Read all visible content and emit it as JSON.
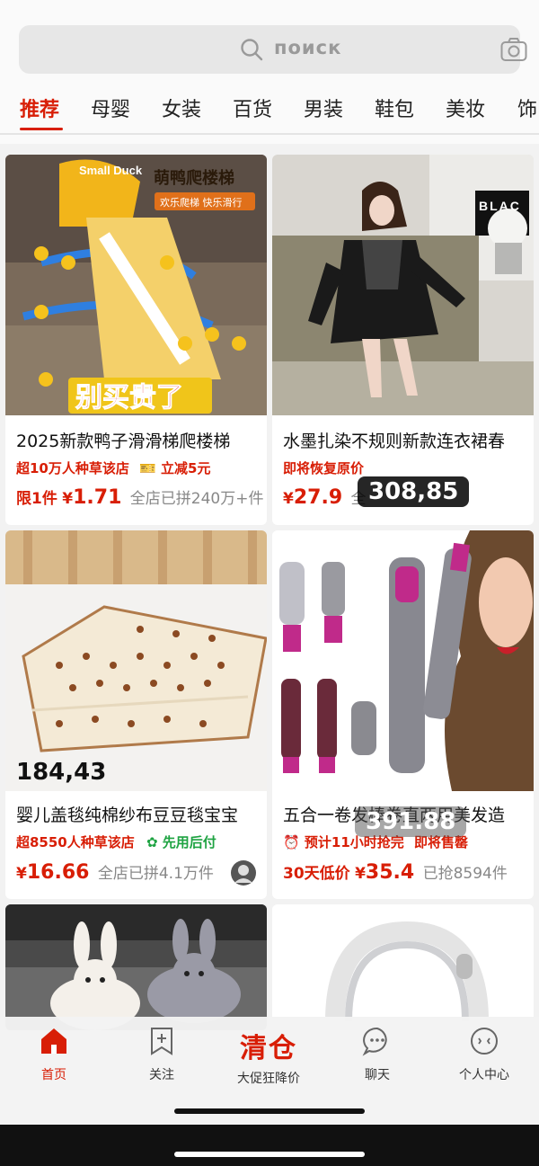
{
  "search": {
    "placeholder": "поиск"
  },
  "tabs": [
    "推荐",
    "母婴",
    "女装",
    "百货",
    "男装",
    "鞋包",
    "美妆",
    "饰"
  ],
  "products": [
    {
      "title": "2025新款鸭子滑滑梯爬楼梯",
      "tag1": "超10万人种草该店",
      "tag2": "立减5元",
      "limit": "限1件",
      "price_symbol": "¥",
      "price": "1.71",
      "sold": "全店已拼240万+件",
      "image_texts": {
        "brand": "Small Duck",
        "headline": "萌鸭爬楼梯",
        "sub": "欢乐爬梯 快乐滑行",
        "banner": "别买贵了"
      }
    },
    {
      "title": "水墨扎染不规则新款连衣裙春",
      "tag1": "即将恢复原价",
      "price_symbol": "¥",
      "price": "27.9",
      "sold": "全",
      "overlay": "308,85",
      "image_texts": {
        "sign": "BLAC"
      }
    },
    {
      "title": "婴儿盖毯纯棉纱布豆豆毯宝宝",
      "tag1": "超8550人种草该店",
      "tag2": "先用后付",
      "price_symbol": "¥",
      "price": "16.66",
      "sold": "全店已拼4.1万件",
      "overlay": "184,43"
    },
    {
      "title": "五合一卷发棒卷直两用美发造",
      "tag1": "预计11小时抢完",
      "tag2": "即将售罄",
      "limit": "30天低价",
      "price_symbol": "¥",
      "price": "35.4",
      "sold": "已抢8594件",
      "overlay": "391.88"
    }
  ],
  "bottom_nav": {
    "home": "首页",
    "follow": "关注",
    "center_big": "清仓",
    "center_sub": "大促狂降价",
    "chat": "聊天",
    "profile": "个人中心"
  },
  "colors": {
    "accent": "#d81e06",
    "green": "#1ea342"
  }
}
